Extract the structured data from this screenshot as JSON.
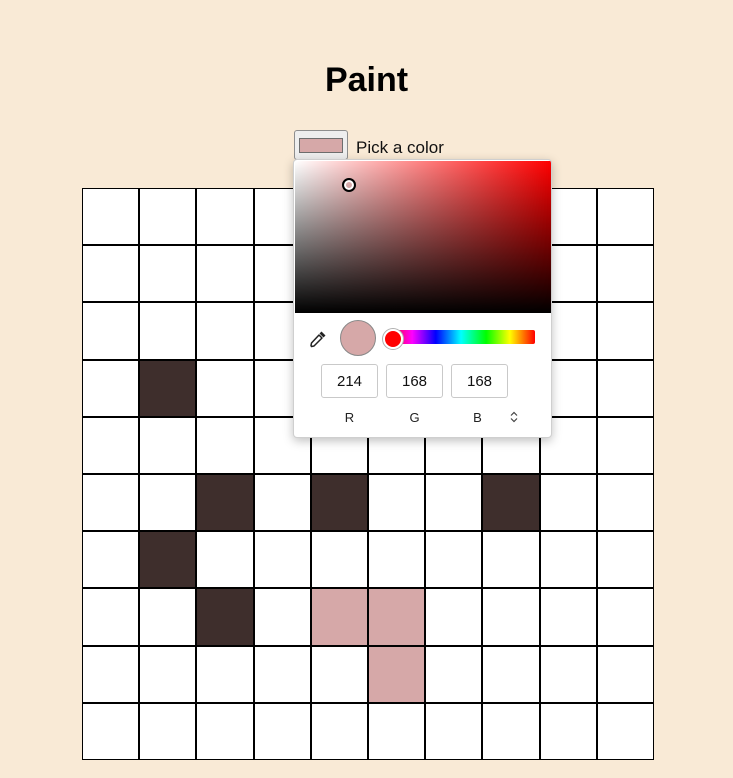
{
  "page": {
    "title": "Paint"
  },
  "color_picker": {
    "label": "Pick a color",
    "current_color": "#d6a8a8",
    "hue_color": "#ff0000",
    "icons": {
      "eyedropper": "eyedropper-icon",
      "mode_toggle": "chevron-up-down-icon"
    },
    "mode_toggle_glyph": "⌃⌄",
    "channels": [
      {
        "label": "R",
        "value": "214"
      },
      {
        "label": "G",
        "value": "168"
      },
      {
        "label": "B",
        "value": "168"
      }
    ]
  },
  "canvas": {
    "rows": 10,
    "cols": 10,
    "default_color": "#ffffff",
    "colored_cells": [
      {
        "row": 3,
        "col": 1,
        "color": "#3e2e2c"
      },
      {
        "row": 5,
        "col": 2,
        "color": "#3e2e2c"
      },
      {
        "row": 5,
        "col": 4,
        "color": "#3e2e2c"
      },
      {
        "row": 5,
        "col": 7,
        "color": "#3e2e2c"
      },
      {
        "row": 6,
        "col": 1,
        "color": "#3e2e2c"
      },
      {
        "row": 7,
        "col": 2,
        "color": "#3e2e2c"
      },
      {
        "row": 7,
        "col": 4,
        "color": "#d6a8a8"
      },
      {
        "row": 7,
        "col": 5,
        "color": "#d6a8a8"
      },
      {
        "row": 8,
        "col": 5,
        "color": "#d6a8a8"
      }
    ]
  }
}
